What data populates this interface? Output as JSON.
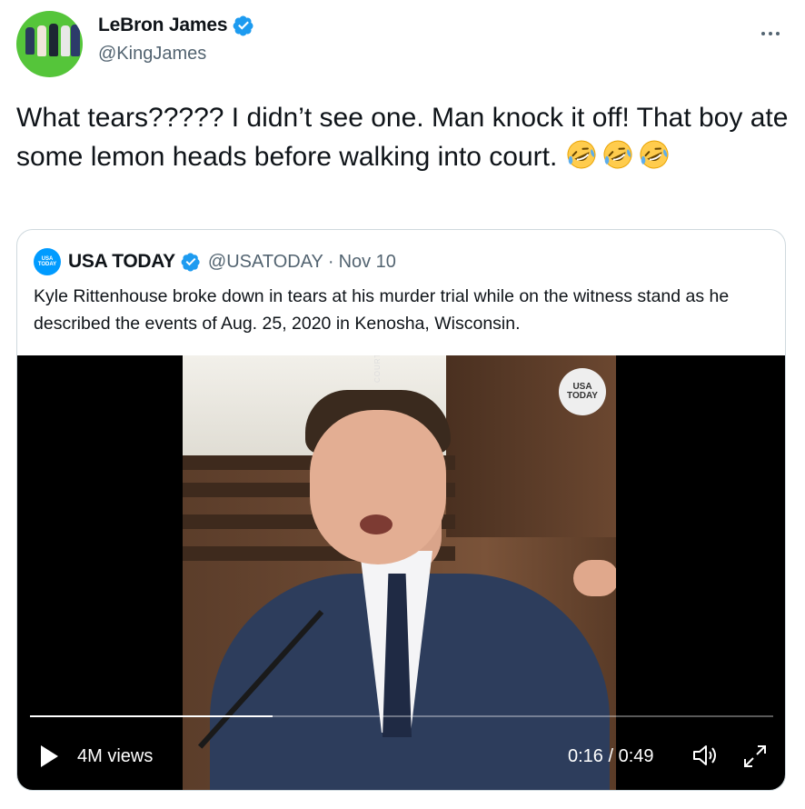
{
  "author": {
    "display_name": "LeBron James",
    "handle": "@KingJames",
    "verified": true
  },
  "tweet": {
    "text": "What tears????? I didn’t see one. Man knock it off! That boy ate some lemon heads before walking into court.",
    "emoji": [
      "rolling-on-floor-laughing",
      "rolling-on-floor-laughing",
      "rolling-on-floor-laughing"
    ]
  },
  "quoted_tweet": {
    "display_name": "USA TODAY",
    "handle": "@USATODAY",
    "separator": "·",
    "date": "Nov 10",
    "logo_text": [
      "USA",
      "TODAY"
    ],
    "text": "Kyle Rittenhouse broke down in tears at his murder trial while on the witness stand as he described the events of Aug. 25, 2020 in Kenosha, Wisconsin.",
    "video": {
      "watermark": "COURTTV",
      "badge_text": [
        "USA",
        "TODAY"
      ],
      "progress": 0.326,
      "views": "4M views",
      "current_time": "0:16",
      "duration": "0:49",
      "time_display": "0:16 / 0:49"
    }
  },
  "colors": {
    "verified_blue": "#1d9bf0",
    "secondary_text": "#536471",
    "border": "#cfd9de",
    "usatoday_blue": "#009bff"
  }
}
